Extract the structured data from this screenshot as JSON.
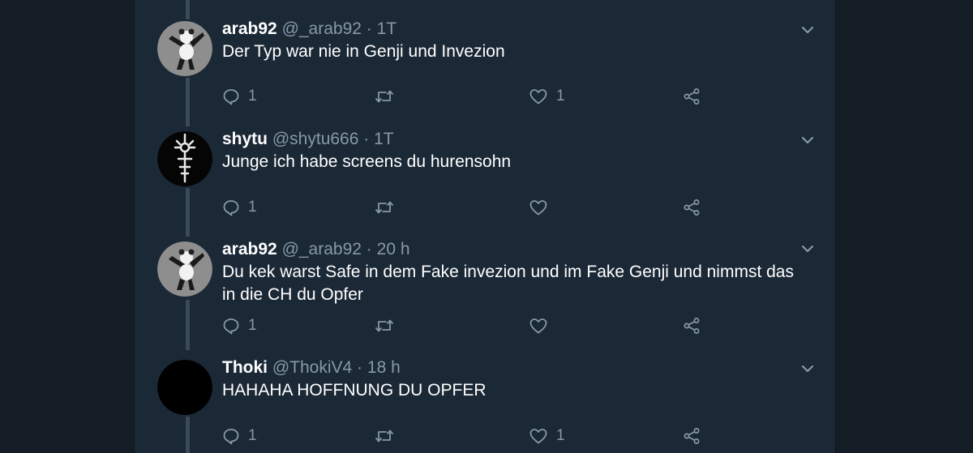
{
  "tweets": [
    {
      "name": "arab92",
      "handle": "@_arab92",
      "separator": "·",
      "time": "1T",
      "text": "Der Typ war nie in Genji und Invezion",
      "avatar": "panda-dab",
      "reply_count": "1",
      "retweet_count": "",
      "like_count": "1"
    },
    {
      "name": "shytu",
      "handle": "@shytu666",
      "separator": "·",
      "time": "1T",
      "text": "Junge ich habe screens du hurensohn",
      "avatar": "white-symbol",
      "reply_count": "1",
      "retweet_count": "",
      "like_count": ""
    },
    {
      "name": "arab92",
      "handle": "@_arab92",
      "separator": "·",
      "time": "20 h",
      "text": "Du kek warst Safe in dem Fake invezion und im Fake Genji und nimmst das in die CH du Opfer",
      "avatar": "panda-dab",
      "reply_count": "1",
      "retweet_count": "",
      "like_count": ""
    },
    {
      "name": "Thoki",
      "handle": "@ThokiV4",
      "separator": "·",
      "time": "18 h",
      "text": "HAHAHA HOFFNUNG DU OPFER",
      "avatar": "black",
      "reply_count": "1",
      "retweet_count": "",
      "like_count": "1"
    }
  ],
  "icons": {
    "reply": "reply-icon",
    "retweet": "retweet-icon",
    "like": "heart-icon",
    "share": "share-icon",
    "menu": "chevron-down-icon"
  },
  "colors": {
    "background": "#141d26",
    "column": "#1b2836",
    "text_primary": "#ffffff",
    "text_secondary": "#8899a6",
    "thread_line": "#3b4a5a"
  }
}
